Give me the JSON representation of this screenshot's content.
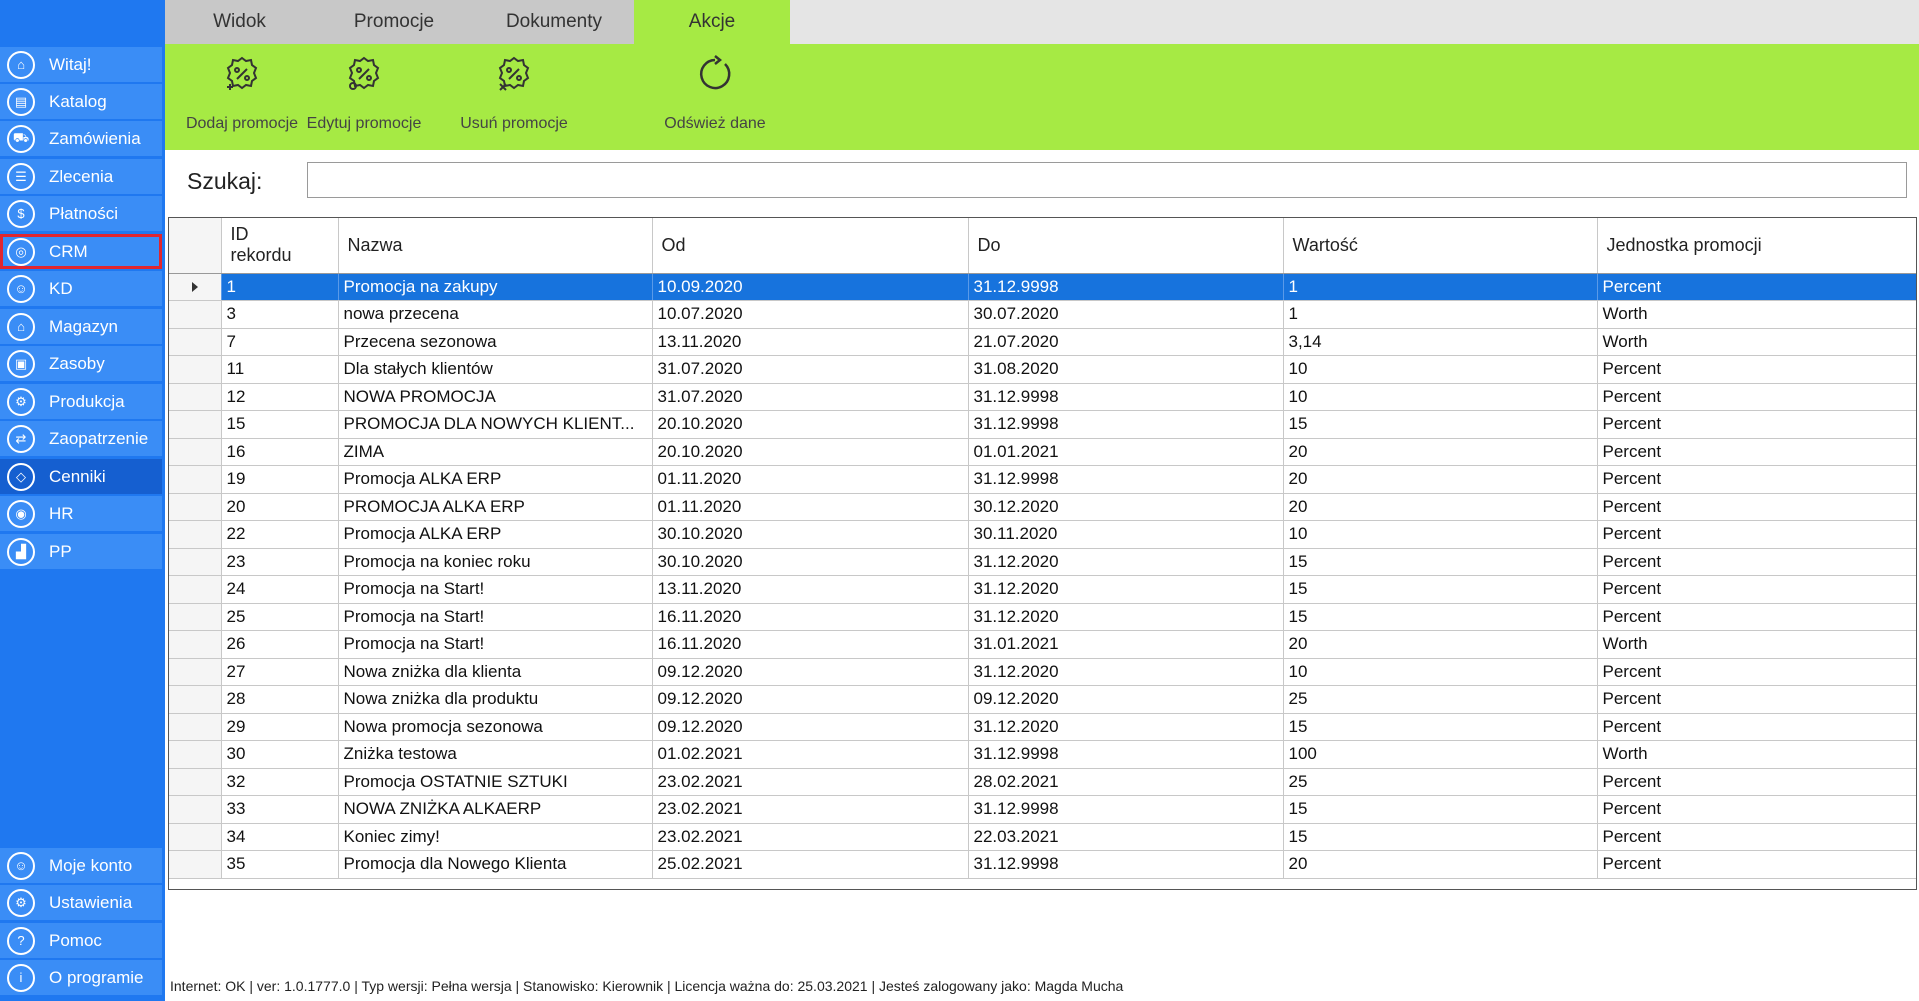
{
  "sidebar": {
    "items": [
      {
        "label": "Witaj!",
        "icon": "home-icon"
      },
      {
        "label": "Katalog",
        "icon": "book-icon"
      },
      {
        "label": "Zamówienia",
        "icon": "cart-icon"
      },
      {
        "label": "Zlecenia",
        "icon": "list-icon"
      },
      {
        "label": "Płatności",
        "icon": "dollar-icon"
      },
      {
        "label": "CRM",
        "icon": "crm-icon"
      },
      {
        "label": "KD",
        "icon": "user-icon"
      },
      {
        "label": "Magazyn",
        "icon": "warehouse-icon"
      },
      {
        "label": "Zasoby",
        "icon": "box-icon"
      },
      {
        "label": "Produkcja",
        "icon": "gear-icon"
      },
      {
        "label": "Zaopatrzenie",
        "icon": "truck-icon"
      },
      {
        "label": "Cenniki",
        "icon": "tag-icon"
      },
      {
        "label": "HR",
        "icon": "people-icon"
      },
      {
        "label": "PP",
        "icon": "factory-icon"
      }
    ],
    "bottom_items": [
      {
        "label": "Moje konto",
        "icon": "account-icon"
      },
      {
        "label": "Ustawienia",
        "icon": "settings-icon"
      },
      {
        "label": "Pomoc",
        "icon": "help-icon"
      },
      {
        "label": "O programie",
        "icon": "info-icon"
      }
    ],
    "active_item": "Cenniki",
    "highlighted_item": "CRM"
  },
  "tabs": [
    {
      "label": "Widok"
    },
    {
      "label": "Promocje"
    },
    {
      "label": "Dokumenty"
    },
    {
      "label": "Akcje"
    }
  ],
  "active_tab": "Akcje",
  "ribbon": {
    "buttons": [
      {
        "label": "Dodaj promocje",
        "icon": "add-promo-icon"
      },
      {
        "label": "Edytuj promocje",
        "icon": "edit-promo-icon"
      },
      {
        "label": "Usuń promocje",
        "icon": "delete-promo-icon"
      },
      {
        "label": "Odśwież dane",
        "icon": "refresh-icon"
      }
    ]
  },
  "search": {
    "label": "Szukaj:",
    "value": "",
    "placeholder": ""
  },
  "grid": {
    "columns": [
      "ID rekordu",
      "Nazwa",
      "Od",
      "Do",
      "Wartość",
      "Jednostka promocji"
    ],
    "selected_row": 0,
    "rows": [
      [
        "1",
        "Promocja na zakupy",
        "10.09.2020",
        "31.12.9998",
        "1",
        "Percent"
      ],
      [
        "3",
        "nowa przecena",
        "10.07.2020",
        "30.07.2020",
        "1",
        "Worth"
      ],
      [
        "7",
        "Przecena sezonowa",
        "13.11.2020",
        "21.07.2020",
        "3,14",
        "Worth"
      ],
      [
        "11",
        "Dla stałych klientów",
        "31.07.2020",
        "31.08.2020",
        "10",
        "Percent"
      ],
      [
        "12",
        "NOWA PROMOCJA",
        "31.07.2020",
        "31.12.9998",
        "10",
        "Percent"
      ],
      [
        "15",
        "PROMOCJA DLA NOWYCH KLIENT...",
        "20.10.2020",
        "31.12.9998",
        "15",
        "Percent"
      ],
      [
        "16",
        "ZIMA",
        "20.10.2020",
        "01.01.2021",
        "20",
        "Percent"
      ],
      [
        "19",
        "Promocja ALKA ERP",
        "01.11.2020",
        "31.12.9998",
        "20",
        "Percent"
      ],
      [
        "20",
        "PROMOCJA ALKA ERP",
        "01.11.2020",
        "30.12.2020",
        "20",
        "Percent"
      ],
      [
        "22",
        "Promocja ALKA ERP",
        "30.10.2020",
        "30.11.2020",
        "10",
        "Percent"
      ],
      [
        "23",
        "Promocja na koniec roku",
        "30.10.2020",
        "31.12.2020",
        "15",
        "Percent"
      ],
      [
        "24",
        "Promocja na Start!",
        "13.11.2020",
        "31.12.2020",
        "15",
        "Percent"
      ],
      [
        "25",
        "Promocja na Start!",
        "16.11.2020",
        "31.12.2020",
        "15",
        "Percent"
      ],
      [
        "26",
        "Promocja na Start!",
        "16.11.2020",
        "31.01.2021",
        "20",
        "Worth"
      ],
      [
        "27",
        "Nowa zniżka dla klienta",
        "09.12.2020",
        "31.12.2020",
        "10",
        "Percent"
      ],
      [
        "28",
        "Nowa zniżka dla produktu",
        "09.12.2020",
        "09.12.2020",
        "25",
        "Percent"
      ],
      [
        "29",
        "Nowa promocja sezonowa",
        "09.12.2020",
        "31.12.2020",
        "15",
        "Percent"
      ],
      [
        "30",
        "Zniżka testowa",
        "01.02.2021",
        "31.12.9998",
        "100",
        "Worth"
      ],
      [
        "32",
        "Promocja OSTATNIE SZTUKI",
        "23.02.2021",
        "28.02.2021",
        "25",
        "Percent"
      ],
      [
        "33",
        "NOWA ZNIŻKA ALKAERP",
        "23.02.2021",
        "31.12.9998",
        "15",
        "Percent"
      ],
      [
        "34",
        "Koniec zimy!",
        "23.02.2021",
        "22.03.2021",
        "15",
        "Percent"
      ],
      [
        "35",
        "Promocja dla Nowego Klienta",
        "25.02.2021",
        "31.12.9998",
        "20",
        "Percent"
      ]
    ]
  },
  "statusbar": {
    "text": "Internet: OK  |   ver: 1.0.1777.0   |   Typ wersji: Pełna wersja   |   Stanowisko: Kierownik   |   Licencja ważna do: 25.03.2021   |   Jesteś zalogowany jako: Magda Mucha"
  },
  "colors": {
    "sidebar_bg": "#1f78f0",
    "sidebar_item": "#3a8df6",
    "sidebar_active": "#155fd0",
    "ribbon_bg": "#a6ea44",
    "selected_row": "#1773dd",
    "highlight_outline": "#e0262f"
  }
}
